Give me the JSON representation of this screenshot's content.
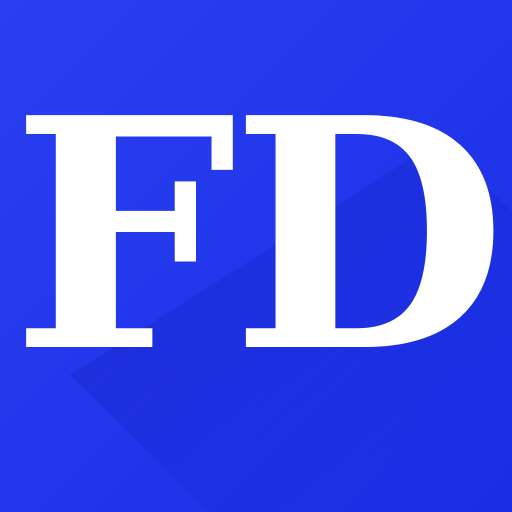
{
  "app_icon": {
    "logo_text": "FD",
    "colors": {
      "background": "#1a2ee6",
      "background_light": "#2a3ff0",
      "long_shadow": "#1424c8",
      "letters": "#ffffff"
    }
  }
}
